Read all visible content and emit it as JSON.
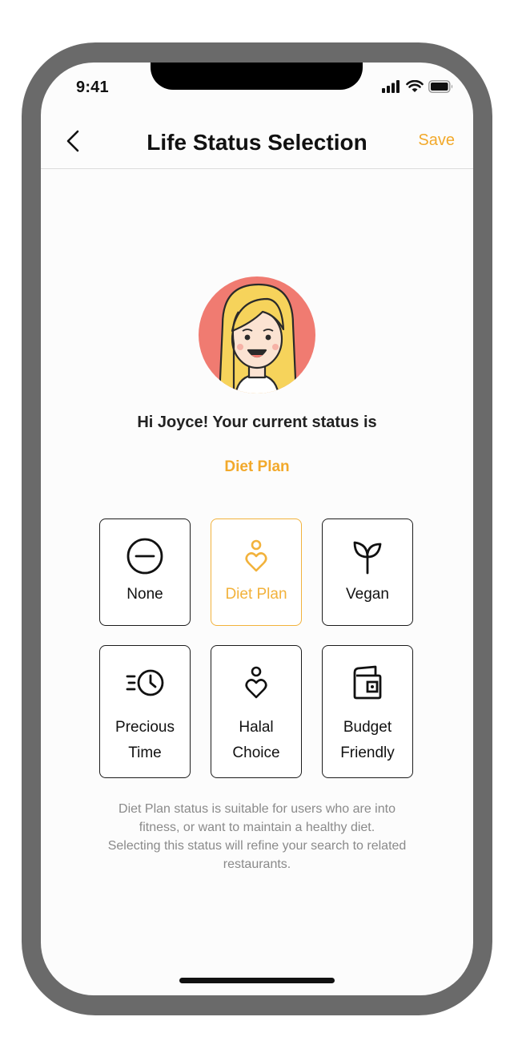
{
  "status_bar": {
    "time": "9:41"
  },
  "nav": {
    "back_icon": "chevron-left-icon",
    "title": "Life Status Selection",
    "save_label": "Save"
  },
  "profile": {
    "greeting": "Hi Joyce! Your current status is",
    "current_status": "Diet Plan"
  },
  "statuses": [
    {
      "label": "None",
      "icon": "minus-circle-icon",
      "selected": false
    },
    {
      "label": "Diet Plan",
      "icon": "heart-person-icon",
      "selected": true
    },
    {
      "label": "Vegan",
      "icon": "sprout-icon",
      "selected": false
    },
    {
      "label_line1": "Precious",
      "label_line2": "Time",
      "icon": "fast-clock-icon",
      "selected": false
    },
    {
      "label_line1": "Halal",
      "label_line2": "Choice",
      "icon": "heart-person-icon",
      "selected": false
    },
    {
      "label_line1": "Budget",
      "label_line2": "Friendly",
      "icon": "wallet-icon",
      "selected": false
    }
  ],
  "description": {
    "line1": "Diet Plan status is suitable for users who are into",
    "line2": "fitness, or want to maintain a healthy diet.",
    "line3": "Selecting this status will refine your search to related",
    "line4": "restaurants."
  },
  "colors": {
    "accent": "#f2a92b",
    "avatar_bg": "#f07b71",
    "text": "#111111",
    "muted": "#8a8a8a"
  }
}
